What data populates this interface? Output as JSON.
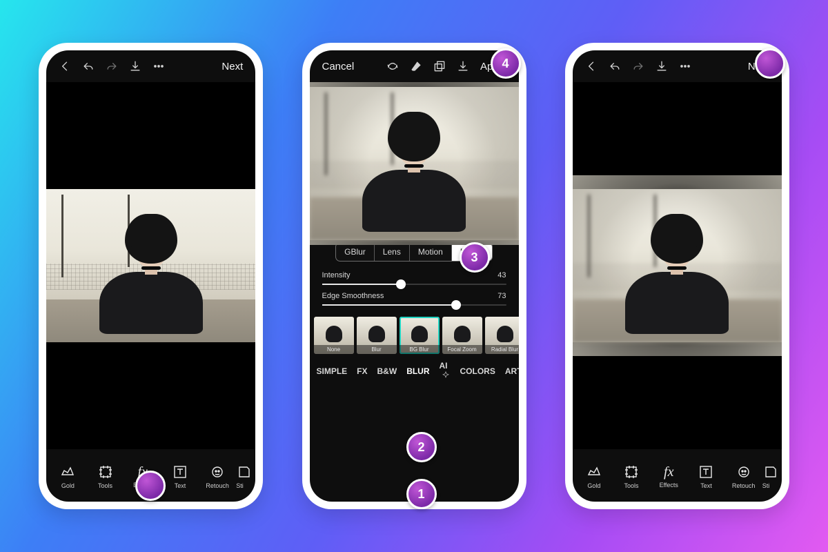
{
  "markers": {
    "effects": "",
    "cat": "1",
    "thumb": "2",
    "seg": "3",
    "apply": "4",
    "next": ""
  },
  "phone1": {
    "top": {
      "next": "Next"
    },
    "tools": {
      "gold": "Gold",
      "tools": "Tools",
      "effects": "Effects",
      "text": "Text",
      "retouch": "Retouch",
      "sticker": "Sti"
    }
  },
  "phone2": {
    "top": {
      "cancel": "Cancel",
      "apply": "Apply"
    },
    "seg": {
      "gblur": "GBlur",
      "lens": "Lens",
      "motion": "Motion",
      "radial": "Radial"
    },
    "sliders": {
      "intensity": {
        "label": "Intensity",
        "value": "43",
        "pct": 43
      },
      "edge": {
        "label": "Edge Smoothness",
        "value": "73",
        "pct": 73
      }
    },
    "thumbs": {
      "none": "None",
      "blur": "Blur",
      "bgblur": "BG Blur",
      "focal": "Focal Zoom",
      "radial": "Radial Blur"
    },
    "cats": {
      "simple": "SIMPLE",
      "fx": "FX",
      "bw": "B&W",
      "blur": "BLUR",
      "ai": "AI",
      "colors": "COLORS",
      "art": "ART"
    }
  },
  "phone3": {
    "top": {
      "next": "Next"
    },
    "tools": {
      "gold": "Gold",
      "tools": "Tools",
      "effects": "Effects",
      "text": "Text",
      "retouch": "Retouch",
      "sticker": "Sti"
    }
  }
}
